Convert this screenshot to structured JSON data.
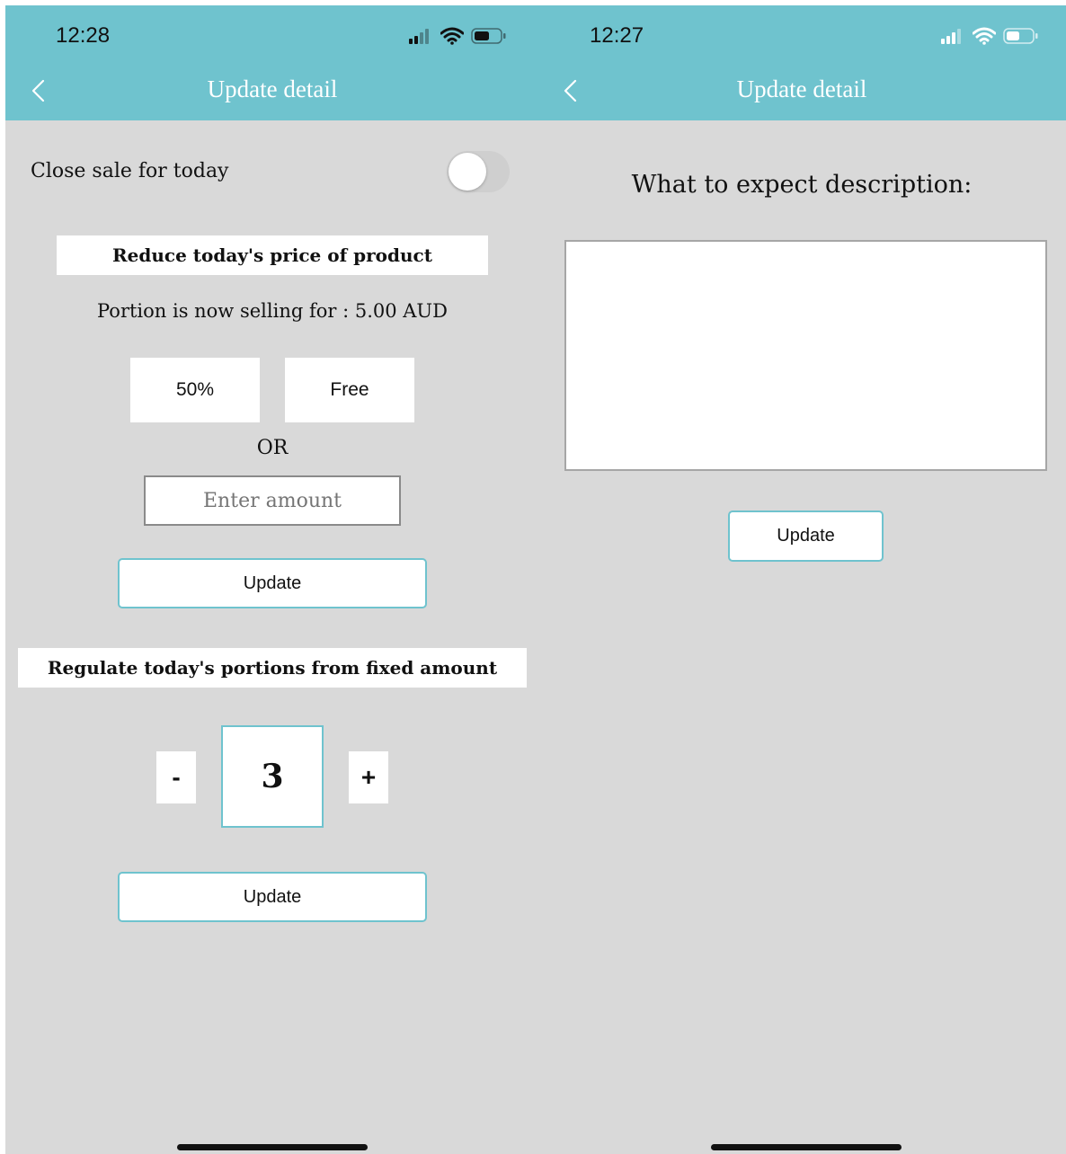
{
  "left_screen": {
    "status_time": "12:28",
    "title": "Update detail",
    "close_sale_label": "Close sale for today",
    "close_sale_toggle_on": false,
    "reduce_section_title": "Reduce today's price of product",
    "price_info": "Portion is now selling for : 5.00 AUD",
    "discount_options": [
      "50%",
      "Free"
    ],
    "or_label": "OR",
    "amount_input": {
      "value": "",
      "placeholder": "Enter amount"
    },
    "update_button_1": "Update",
    "regulate_section_title": "Regulate today's portions from fixed amount",
    "stepper": {
      "minus": "-",
      "value": "3",
      "plus": "+"
    },
    "update_button_2": "Update"
  },
  "right_screen": {
    "status_time": "12:27",
    "title": "Update detail",
    "description_heading": "What to expect description:",
    "description_input": {
      "value": "",
      "placeholder": ""
    },
    "update_button": "Update"
  },
  "icons": {
    "back": "chevron-left-icon",
    "signal": "cellular-signal-icon",
    "wifi": "wifi-icon",
    "battery": "battery-icon"
  },
  "colors": {
    "header": "#6fc3ce",
    "background": "#d9d9d9",
    "accent_border": "#6fc3ce"
  }
}
